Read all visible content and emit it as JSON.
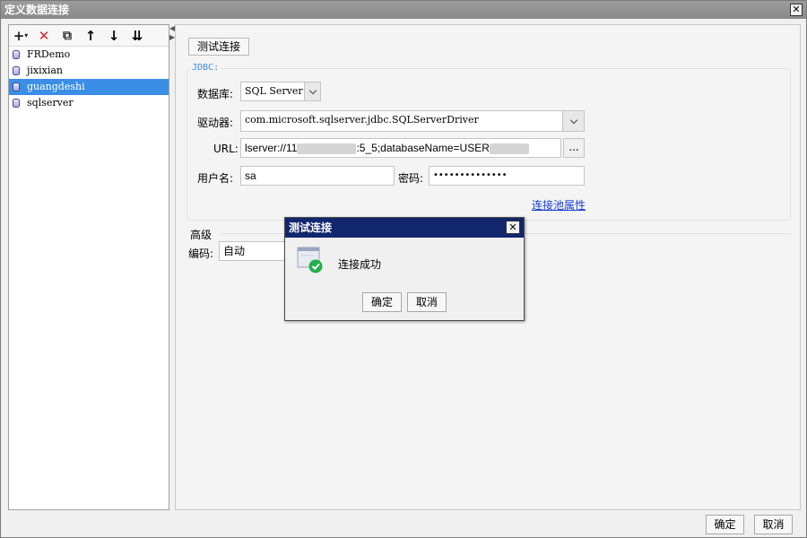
{
  "window": {
    "title": "定义数据连接",
    "close_glyph": "✕"
  },
  "toolbar": {
    "add_glyph": "+",
    "add_menu_glyph": "▾",
    "delete_glyph": "✕",
    "copy_glyph": "⧉",
    "move_up_glyph": "↑",
    "move_down_glyph": "↓",
    "sort_glyph": "⇊"
  },
  "splitter": {
    "glyph": "◀ ▶"
  },
  "connections": [
    {
      "name": "FRDemo",
      "selected": false
    },
    {
      "name": "jixixian",
      "selected": false
    },
    {
      "name": "guangdeshi",
      "selected": true
    },
    {
      "name": "sqlserver",
      "selected": false
    }
  ],
  "form": {
    "test_button": "测试连接",
    "jdbc_legend": "JDBC:",
    "database_label": "数据库:",
    "database_value": "SQL Server",
    "driver_label": "驱动器:",
    "driver_value": "com.microsoft.sqlserver.jdbc.SQLServerDriver",
    "url_label": "URL:",
    "url_value_prefix": "lserver://11",
    "url_value_middle": ":5_5;databaseName=USER",
    "url_browse": "...",
    "user_label": "用户名:",
    "user_value": "sa",
    "password_label": "密码:",
    "password_value": "••••••••••••••",
    "pool_link": "连接池属性",
    "advanced_title": "高级",
    "encoding_label": "编码:",
    "encoding_value": "自动"
  },
  "footer": {
    "ok": "确定",
    "cancel": "取消"
  },
  "dialog": {
    "title": "测试连接",
    "close_glyph": "✕",
    "message": "连接成功",
    "ok": "确定",
    "cancel": "取消"
  },
  "colors": {
    "selection": "#3a8ee6",
    "dialog_titlebar": "#12266e",
    "link": "#1a3fd1",
    "success": "#22b04b"
  },
  "icons": {
    "database": "database-icon",
    "success": "success-check-icon"
  }
}
